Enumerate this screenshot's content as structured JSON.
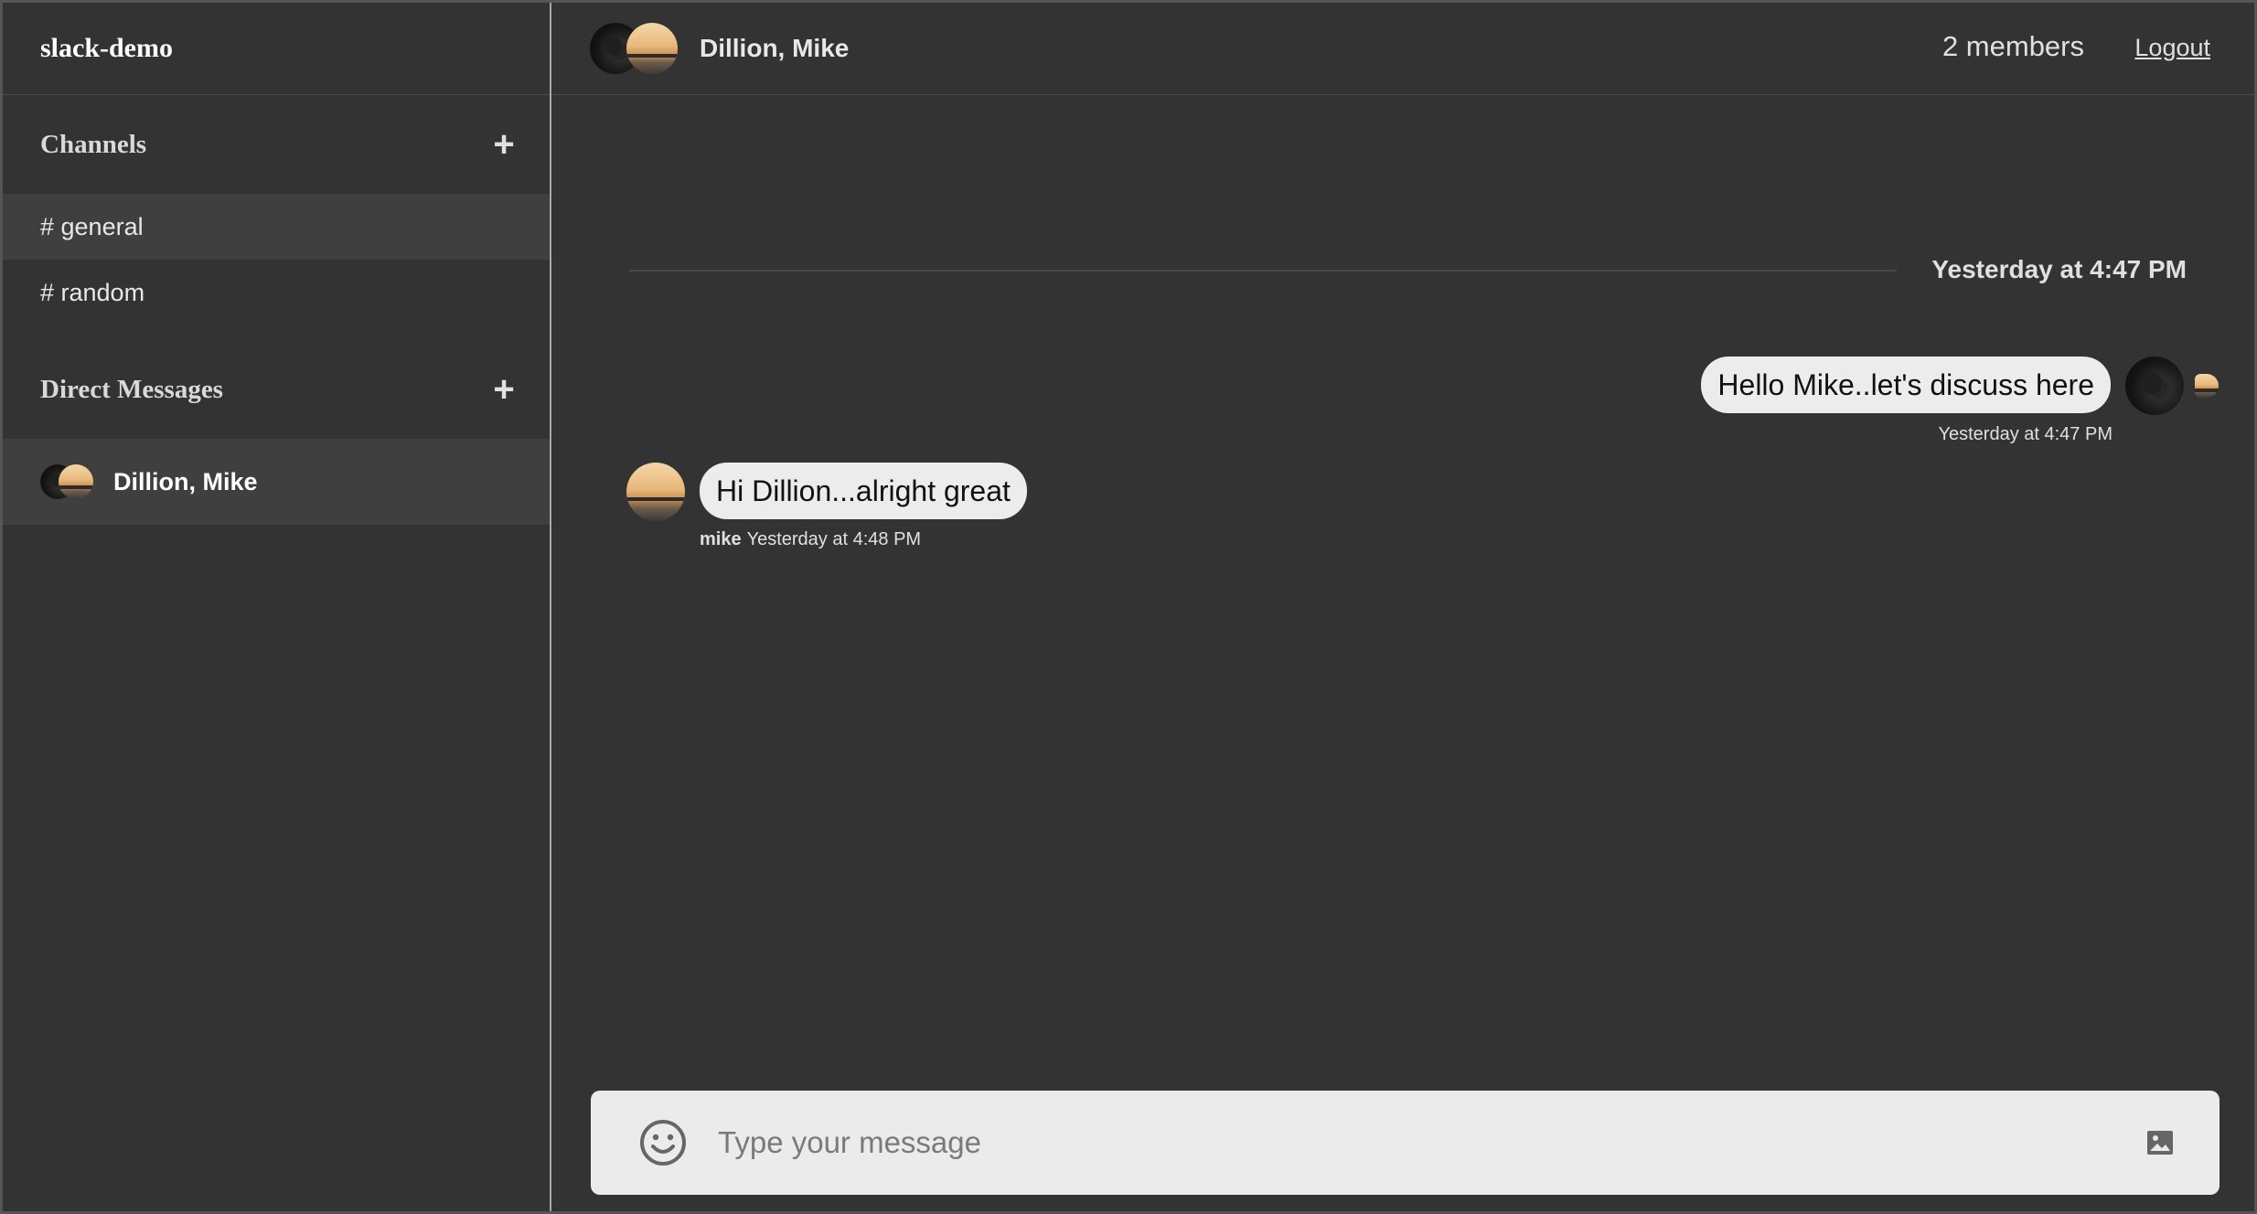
{
  "workspace": {
    "name": "slack-demo"
  },
  "sidebar": {
    "channels_title": "Channels",
    "channels": [
      {
        "label": "# general",
        "active": true
      },
      {
        "label": "# random",
        "active": false
      }
    ],
    "dm_title": "Direct Messages",
    "dms": [
      {
        "label": "Dillion, Mike",
        "active": true
      }
    ],
    "add_glyph": "+"
  },
  "chat": {
    "title": "Dillion, Mike",
    "members": "2 members",
    "logout": "Logout",
    "date_divider": "Yesterday at 4:47 PM",
    "messages": [
      {
        "text": "Hello Mike..let's discuss here",
        "time": "Yesterday at 4:47 PM",
        "direction": "outgoing"
      },
      {
        "author": "mike",
        "text": "Hi Dillion...alright great",
        "time": "Yesterday at 4:48 PM",
        "direction": "incoming"
      }
    ]
  },
  "composer": {
    "placeholder": "Type your message",
    "emoji_icon": "smiley-icon",
    "attach_icon": "image-icon"
  },
  "colors": {
    "background": "#333333",
    "active_item": "#3f3f3f",
    "bubble": "#ececec",
    "composer": "#ebebeb"
  }
}
